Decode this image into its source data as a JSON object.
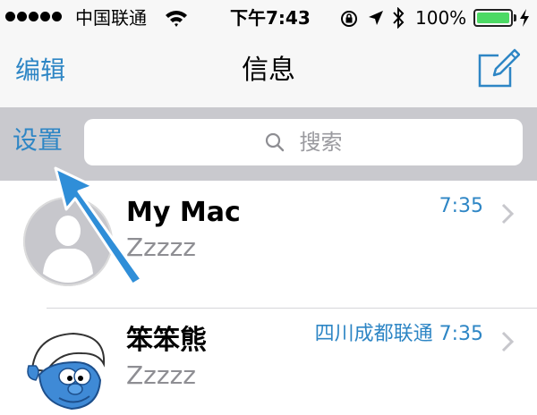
{
  "status_bar": {
    "carrier": "中国联通",
    "time": "下午7:43",
    "battery_percent": "100%",
    "signal_bars": 5,
    "battery_level": 1.0,
    "icons": [
      "signal-dots-icon",
      "wifi-icon",
      "rotation-lock-icon",
      "location-arrow-icon",
      "bluetooth-icon",
      "battery-icon",
      "charging-bolt-icon"
    ]
  },
  "nav": {
    "left_label": "编辑",
    "title": "信息",
    "right_icon": "compose-icon"
  },
  "search": {
    "settings_label": "设置",
    "placeholder": "搜索",
    "icon": "magnifier-icon"
  },
  "conversations": [
    {
      "name": "My Mac",
      "preview": "Zzzzz",
      "time": "7:35",
      "avatar": "default-person-avatar"
    },
    {
      "name": "笨笨熊",
      "preview": "Zzzzz",
      "time": "四川成都联通 7:35",
      "avatar": "smurf-avatar"
    }
  ],
  "colors": {
    "accent": "#2e86c5",
    "search_bar_bg": "#c9c9ce",
    "battery_green": "#4cd964",
    "annotation_arrow": "#2f8ed8"
  }
}
